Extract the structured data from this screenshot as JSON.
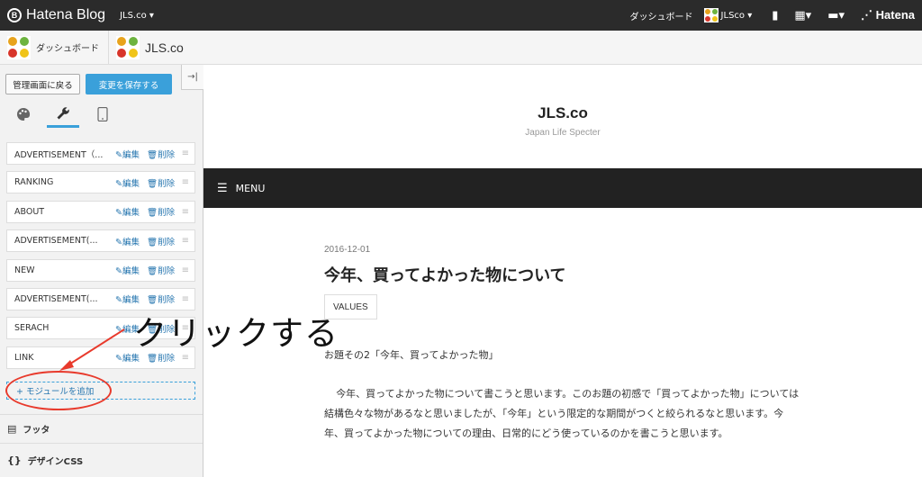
{
  "topbar": {
    "brand": "Hatena Blog",
    "blog_selector": "JLS.co ▾",
    "dashboard_link": "ダッシュボード",
    "user_menu": "JLSco ▾",
    "hatena_brand": "Hatena",
    "bg_color": "#2b2b2b"
  },
  "subbar": {
    "dashboard_label": "ダッシュボード",
    "blog_name": "JLS.co"
  },
  "sidebar": {
    "back_button": "管理画面に戻る",
    "save_button": "変更を保存する",
    "collapse_glyph": "→|",
    "tabs": [
      {
        "name": "design-tab",
        "glyph": "🎨"
      },
      {
        "name": "customize-tab",
        "glyph": "🔧"
      },
      {
        "name": "smartphone-tab",
        "glyph": "📱"
      }
    ],
    "modules": [
      {
        "name": "ADVERTISEMENT（...",
        "edit": "編集",
        "delete": "削除"
      },
      {
        "name": "RANKING",
        "edit": "編集",
        "delete": "削除"
      },
      {
        "name": "ABOUT",
        "edit": "編集",
        "delete": "削除"
      },
      {
        "name": "ADVERTISEMENT(...",
        "edit": "編集",
        "delete": "削除"
      },
      {
        "name": "NEW",
        "edit": "編集",
        "delete": "削除"
      },
      {
        "name": "ADVERTISEMENT(...",
        "edit": "編集",
        "delete": "削除"
      },
      {
        "name": "SERACH",
        "edit": "編集",
        "delete": "削除"
      },
      {
        "name": "LINK",
        "edit": "編集",
        "delete": "削除"
      }
    ],
    "add_module": "+ モジュールを追加",
    "footer_section": "フッタ",
    "css_section": "デザインCSS",
    "accent_color": "#3aa0da"
  },
  "annotation": {
    "callout": "クリックする",
    "highlight_color": "#e83a2c"
  },
  "preview": {
    "site_title": "JLS.co",
    "site_subtitle": "Japan Life Specter",
    "menu_label": "MENU",
    "post": {
      "date": "2016-12-01",
      "title": "今年、買ってよかった物について",
      "category": "VALUES",
      "lead": "お題その2「今年、買ってよかった物」",
      "body": "今年、買ってよかった物について書こうと思います。このお題の初感で「買ってよかった物」については結構色々な物があるなと思いましたが、「今年」という限定的な期間がつくと絞られるなと思います。今年、買ってよかった物についての理由、日常的にどう使っているのかを書こうと思います。"
    }
  }
}
